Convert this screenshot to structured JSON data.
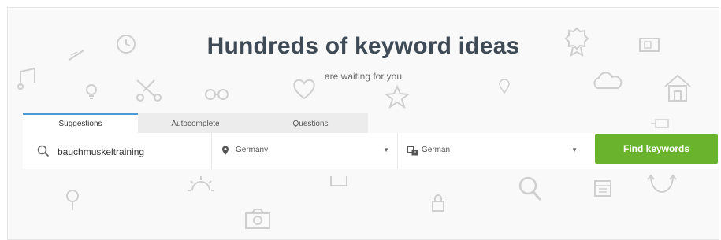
{
  "hero": {
    "title": "Hundreds of keyword ideas",
    "subtitle": "are waiting for you"
  },
  "tabs": [
    {
      "label": "Suggestions",
      "active": true
    },
    {
      "label": "Autocomplete",
      "active": false
    },
    {
      "label": "Questions",
      "active": false
    }
  ],
  "search": {
    "keyword_value": "bauchmuskeltraining",
    "country": "Germany",
    "language": "German",
    "submit_label": "Find keywords"
  },
  "colors": {
    "accent_tab": "#4a9ad6",
    "button_green": "#6ab42d",
    "title": "#3e4a56"
  },
  "background_icons": [
    "music-note-icon",
    "clock-icon",
    "scissors-icon",
    "glasses-icon",
    "heart-icon",
    "star-icon",
    "lightbulb-icon",
    "award-icon",
    "cloud-icon",
    "house-icon",
    "map-pin-icon",
    "sun-icon",
    "magnifier-icon",
    "camera-icon",
    "lock-icon",
    "calendar-icon",
    "arrows-icon",
    "tree-icon"
  ]
}
